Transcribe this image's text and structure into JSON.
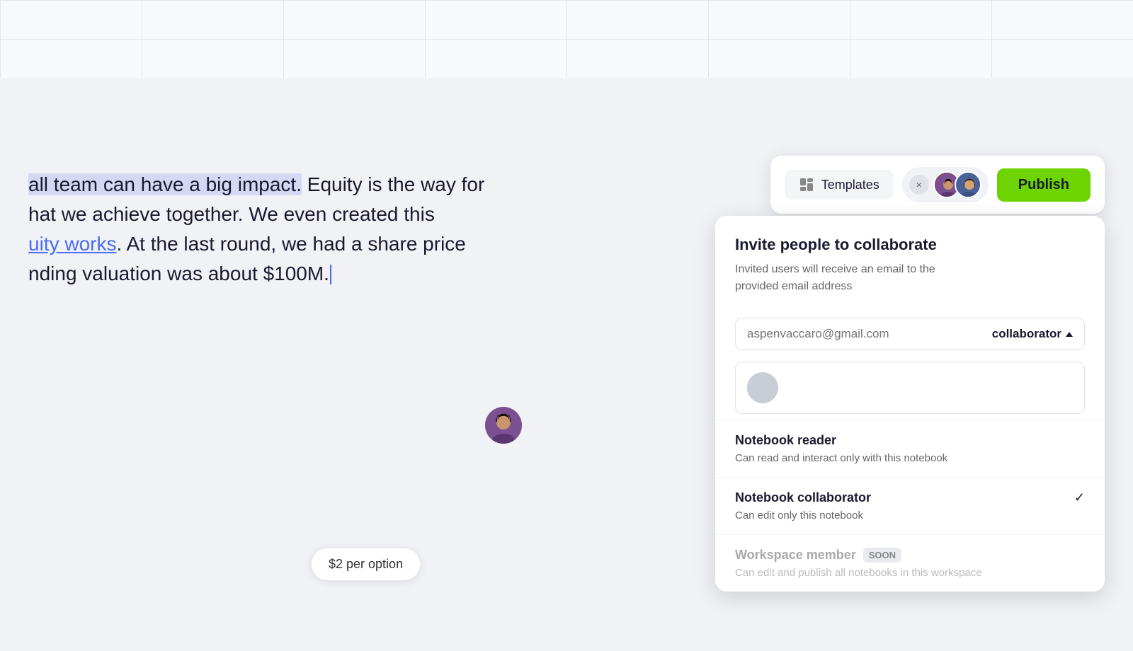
{
  "grid": {
    "visible": true
  },
  "toolbar": {
    "templates_label": "Templates",
    "publish_label": "Publish"
  },
  "collaborators": {
    "close_label": "×"
  },
  "text_content": {
    "line1": "all team can have a big impact.",
    "line1_suffix": " Equity is the way for",
    "line2": "hat we achieve together. We even created this",
    "line3_link": "uity works",
    "line3_suffix": ". At the last round, we had a share price",
    "line4": "nding valuation was about $100M."
  },
  "price_badge": {
    "label": "$2 per option"
  },
  "invite_panel": {
    "title": "Invite people to collaborate",
    "subtitle": "Invited users will receive an email to the\nprovided email address",
    "email_placeholder": "aspenvaccaro@gmail.com",
    "role_label": "collaborator",
    "roles": [
      {
        "name": "Notebook reader",
        "description": "Can read and interact only with this notebook",
        "selected": false,
        "soon": false,
        "disabled": false
      },
      {
        "name": "Notebook collaborator",
        "description": "Can edit only this notebook",
        "selected": true,
        "soon": false,
        "disabled": false
      },
      {
        "name": "Workspace member",
        "description": "Can edit and publish all notebooks in this workspace",
        "selected": false,
        "soon": true,
        "disabled": true
      }
    ]
  }
}
